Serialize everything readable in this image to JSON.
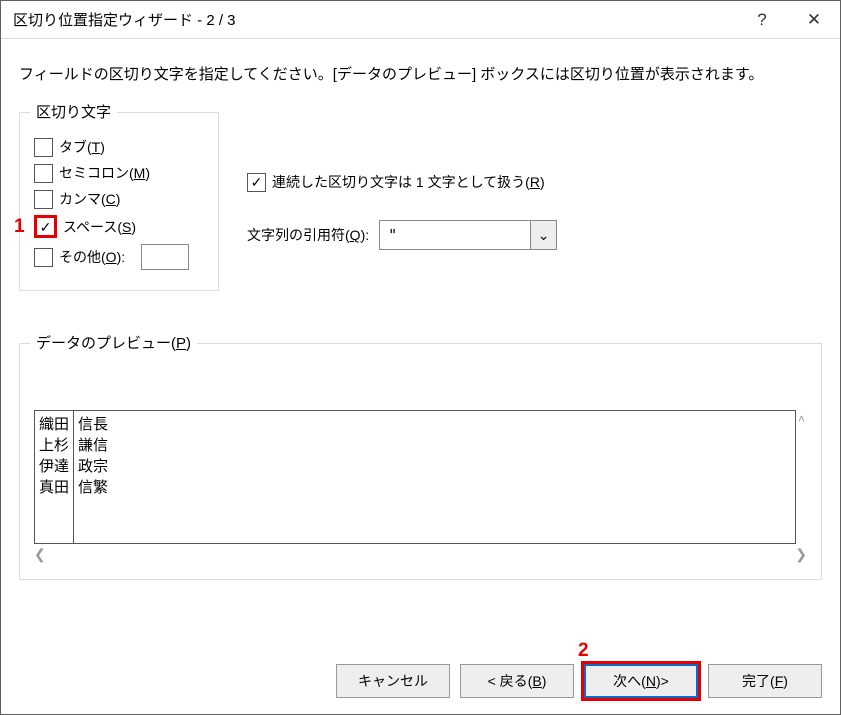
{
  "titlebar": {
    "title": "区切り位置指定ウィザード - 2 / 3",
    "help": "?",
    "close": "✕"
  },
  "instruction": "フィールドの区切り文字を指定してください。[データのプレビュー] ボックスには区切り位置が表示されます。",
  "delimiters": {
    "group_label": "区切り文字",
    "items": [
      {
        "label": "タブ",
        "accel": "T",
        "checked": false
      },
      {
        "label": "セミコロン",
        "accel": "M",
        "checked": false
      },
      {
        "label": "カンマ",
        "accel": "C",
        "checked": false
      },
      {
        "label": "スペース",
        "accel": "S",
        "checked": true,
        "highlight": true,
        "ann": "1"
      },
      {
        "label": "その他",
        "accel": "O",
        "suffix": ":",
        "checked": false,
        "has_input": true,
        "input_value": ""
      }
    ]
  },
  "right": {
    "consecutive": {
      "label_pre": "連続した区切り文字は 1 文字として扱う",
      "accel": "R",
      "checked": true
    },
    "qualifier": {
      "label_pre": "文字列の引用符",
      "accel": "Q",
      "suffix": ":",
      "value": "\""
    }
  },
  "preview": {
    "group_label_pre": "データのプレビュー",
    "group_accel": "P",
    "cols": [
      [
        "織田",
        "上杉",
        "伊達",
        "真田"
      ],
      [
        "信長",
        "謙信",
        "政宗",
        "信繁"
      ]
    ]
  },
  "buttons": {
    "cancel": "キャンセル",
    "back_pre": "< 戻る",
    "back_accel": "B",
    "next_pre": "次へ",
    "next_accel": "N",
    "next_post": " >",
    "next_ann": "2",
    "finish_pre": "完了",
    "finish_accel": "F"
  },
  "glyphs": {
    "check": "✓",
    "chevron_down": "⌄",
    "scroll_left": "❮",
    "scroll_right": "❯",
    "scroll_up": "˄"
  }
}
